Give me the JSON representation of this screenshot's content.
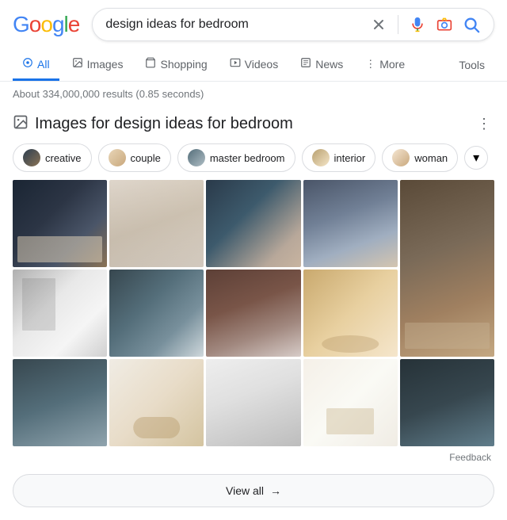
{
  "header": {
    "logo_text": "Google",
    "search_value": "design ideas for bedroom",
    "clear_label": "×"
  },
  "nav": {
    "tabs": [
      {
        "id": "all",
        "label": "All",
        "icon": "🔍",
        "active": true
      },
      {
        "id": "images",
        "label": "Images",
        "icon": "🖼"
      },
      {
        "id": "shopping",
        "label": "Shopping",
        "icon": "🛍"
      },
      {
        "id": "videos",
        "label": "Videos",
        "icon": "▶"
      },
      {
        "id": "news",
        "label": "News",
        "icon": "📰"
      },
      {
        "id": "more",
        "label": "More",
        "icon": "⋮"
      }
    ],
    "tools_label": "Tools"
  },
  "results": {
    "info": "About 334,000,000 results (0.85 seconds)"
  },
  "images_section": {
    "title": "Images for design ideas for bedroom",
    "chips": [
      {
        "label": "creative"
      },
      {
        "label": "couple"
      },
      {
        "label": "master bedroom"
      },
      {
        "label": "interior"
      },
      {
        "label": "woman"
      }
    ]
  },
  "feedback_label": "Feedback",
  "view_all": {
    "label": "View all",
    "arrow": "→"
  }
}
